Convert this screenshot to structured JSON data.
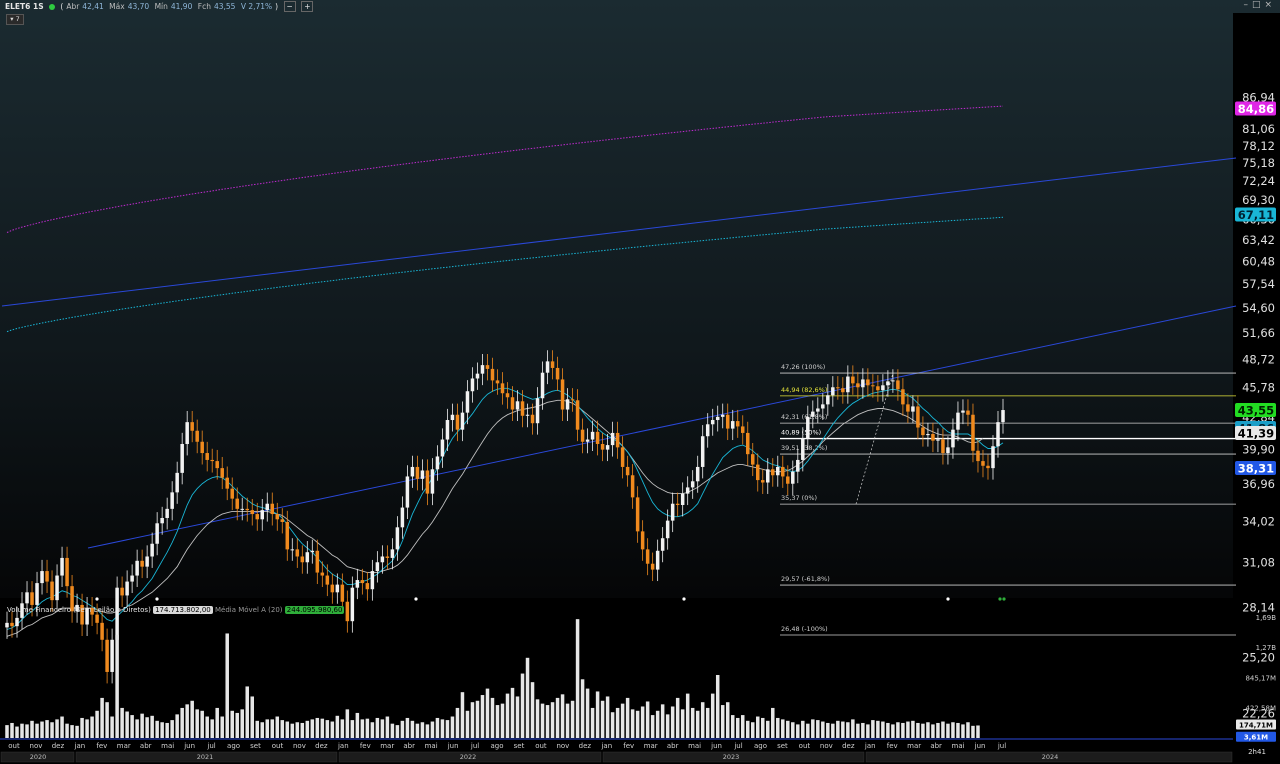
{
  "header": {
    "symbol": "ELET6 1S",
    "open_label": "Abr",
    "open": "42,41",
    "high_label": "Máx",
    "high": "43,70",
    "low_label": "Mín",
    "low": "41,90",
    "close_label": "Fch",
    "close": "43,55",
    "change": "V 2,71%",
    "btn_minus": "−",
    "btn_plus": "+",
    "window_buttons": [
      "–",
      "□",
      "×"
    ]
  },
  "timeframe_button": "▾ 7",
  "price_axis": {
    "ticks": [
      "86,94",
      "81,06",
      "78,12",
      "75,18",
      "72,24",
      "69,30",
      "66,36",
      "63,42",
      "60,48",
      "57,54",
      "54,60",
      "51,66",
      "48,72",
      "45,78",
      "42,84",
      "39,90",
      "36,96",
      "34,02",
      "31,08",
      "28,14",
      "25,20",
      "22,26"
    ],
    "tick_values": [
      86.94,
      81.06,
      78.12,
      75.18,
      72.24,
      69.3,
      66.36,
      63.42,
      60.48,
      57.54,
      54.6,
      51.66,
      48.72,
      45.78,
      42.84,
      39.9,
      36.96,
      34.02,
      31.08,
      28.14,
      25.2,
      22.26
    ],
    "badges": [
      {
        "label": "84,86",
        "value": 84.86,
        "color": "#e026e6",
        "text_color": "#ffffff"
      },
      {
        "label": "67,11",
        "value": 67.11,
        "color": "#19b6d6",
        "text_color": "#002030"
      },
      {
        "label": "43,55",
        "value": 43.55,
        "color": "#22dd22",
        "text_color": "#002200"
      },
      {
        "label": "41,86",
        "value": 41.86,
        "color": "#1a9ec8",
        "text_color": "#002030"
      },
      {
        "label": "41,39",
        "value": 41.39,
        "color": "#e8e8e8",
        "text_color": "#000000"
      },
      {
        "label": "38,31",
        "value": 38.31,
        "color": "#2258e6",
        "text_color": "#ffffff"
      }
    ]
  },
  "fibonacci": [
    {
      "label": "47,26 (100%)",
      "value": 47.26,
      "color": "#cfcfcf"
    },
    {
      "label": "44,94 (82,6%)",
      "value": 44.94,
      "color": "#e4e43a"
    },
    {
      "label": "42,31 (61,8%)",
      "value": 42.31,
      "color": "#cfcfcf"
    },
    {
      "label": "40,89 (50%)",
      "value": 40.89,
      "color": "#ffffff"
    },
    {
      "label": "39,51 (38,2%)",
      "value": 39.51,
      "color": "#cfcfcf"
    },
    {
      "label": "35,37 (0%)",
      "value": 35.37,
      "color": "#cfcfcf"
    },
    {
      "label": "29,57 (-61,8%)",
      "value": 29.57,
      "color": "#cfcfcf"
    },
    {
      "label": "26,48 (-100%)",
      "value": 26.48,
      "color": "#cfcfcf"
    }
  ],
  "volume_header": {
    "title": "Volume Financeiro (Sem Leilão e Diretos)",
    "value": "174.713.802,00",
    "ma_label": "Média Móvel A (20)",
    "ma_value": "244.095.980,60"
  },
  "volume_axis": {
    "ticks": [
      "1,69B",
      "1,27B",
      "845,17M",
      "422,58M"
    ],
    "tick_values": [
      1690,
      1270,
      845.17,
      422.58
    ],
    "badges": [
      {
        "label": "174,71M",
        "value": 174.71,
        "color": "#e8e8e8",
        "text_color": "#000000"
      },
      {
        "label": "3,61M",
        "value": 3.61,
        "color": "#2258e6",
        "text_color": "#ffffff"
      }
    ]
  },
  "time_axis": {
    "months": [
      "out",
      "nov",
      "dez",
      "jan",
      "fev",
      "mar",
      "abr",
      "mai",
      "jun",
      "jul",
      "ago",
      "set",
      "out",
      "nov",
      "dez",
      "jan",
      "fev",
      "mar",
      "abr",
      "mai",
      "jun",
      "jul",
      "ago",
      "set",
      "out",
      "nov",
      "dez",
      "jan",
      "fev",
      "mar",
      "abr",
      "mai",
      "jun",
      "jul",
      "ago",
      "set",
      "out",
      "nov",
      "dez",
      "jan",
      "fev",
      "mar",
      "abr",
      "mai",
      "jun",
      "jul"
    ],
    "years": [
      "2020",
      "2021",
      "2022",
      "2023",
      "2024"
    ],
    "period_label": "2h41"
  },
  "colors": {
    "up": "#f2f2f2",
    "down": "#f08a1e",
    "ma_fast": "#19b6d6",
    "ma_slow": "#bfbfbf",
    "channel": "#2a48d8",
    "env_upper": "#c02ad0",
    "env_lower": "#19b6d6"
  },
  "chart_data": {
    "type": "candlestick",
    "title": "ELET6 1S",
    "interval": "weekly",
    "x_range": [
      "2020-10",
      "2024-07"
    ],
    "ylim": [
      20.5,
      88.5
    ],
    "close_series": [
      27.2,
      27.0,
      27.5,
      28.4,
      29.1,
      28.3,
      29.7,
      30.5,
      29.8,
      28.6,
      30.2,
      31.4,
      29.5,
      27.9,
      28.3,
      27.1,
      28.1,
      27.7,
      27.2,
      26.2,
      24.4,
      26.2,
      29.4,
      28.9,
      29.8,
      30.2,
      31.2,
      30.8,
      31.5,
      32.4,
      33.9,
      34.3,
      35.0,
      36.3,
      37.9,
      40.4,
      42.4,
      41.6,
      40.6,
      39.6,
      39.0,
      38.9,
      38.3,
      37.5,
      36.6,
      35.8,
      35.0,
      35.0,
      34.9,
      34.6,
      34.2,
      34.9,
      35.4,
      34.6,
      34.2,
      34.0,
      32.0,
      32.0,
      31.5,
      31.1,
      31.8,
      31.9,
      30.4,
      30.2,
      29.6,
      29.1,
      29.6,
      28.5,
      27.3,
      29.4,
      29.9,
      29.7,
      29.3,
      30.5,
      31.1,
      31.5,
      31.4,
      32.0,
      33.6,
      35.1,
      37.6,
      38.4,
      37.4,
      38.1,
      36.2,
      38.2,
      39.3,
      40.8,
      42.6,
      43.1,
      41.7,
      43.3,
      45.4,
      46.7,
      47.2,
      48.1,
      47.7,
      46.5,
      46.2,
      45.2,
      44.8,
      43.6,
      44.4,
      43.0,
      43.1,
      42.3,
      44.7,
      47.3,
      48.5,
      47.8,
      46.6,
      43.6,
      44.6,
      44.5,
      41.7,
      40.6,
      40.8,
      41.5,
      40.4,
      39.9,
      40.3,
      41.4,
      40.1,
      38.4,
      37.7,
      35.9,
      33.3,
      32.0,
      31.0,
      30.6,
      31.9,
      32.8,
      34.1,
      35.4,
      35.3,
      36.2,
      36.7,
      37.2,
      38.4,
      41.1,
      42.2,
      42.6,
      42.9,
      43.1,
      41.8,
      42.5,
      42.0,
      41.4,
      39.5,
      38.6,
      37.3,
      37.1,
      38.2,
      37.7,
      38.4,
      37.6,
      37.0,
      38.0,
      39.0,
      40.9,
      42.9,
      43.4,
      43.7,
      44.1,
      45.0,
      45.8,
      45.7,
      45.3,
      46.9,
      46.2,
      45.8,
      46.6,
      46.0,
      45.9,
      45.5,
      46.0,
      46.4,
      46.5,
      45.6,
      44.1,
      43.4,
      43.9,
      41.9,
      41.2,
      41.3,
      40.7,
      40.8,
      39.6,
      40.1,
      41.7,
      43.3,
      43.5,
      43.1,
      39.8,
      38.9,
      38.5,
      38.3,
      40.2,
      42.4,
      43.55
    ],
    "ma_fast_series": [
      26.8,
      26.9,
      27.1,
      27.4,
      27.7,
      27.9,
      28.2,
      28.5,
      28.7,
      28.8,
      29.0,
      29.2,
      29.1,
      28.9,
      28.8,
      28.6,
      28.4,
      28.2,
      28.0,
      27.7,
      27.4,
      27.3,
      27.6,
      27.9,
      28.2,
      28.5,
      28.9,
      29.2,
      29.6,
      30.0,
      30.6,
      31.2,
      31.8,
      32.5,
      33.3,
      34.3,
      35.3,
      36.1,
      36.6,
      37.0,
      37.3,
      37.5,
      37.6,
      37.5,
      37.2,
      36.8,
      36.4,
      36.0,
      35.7,
      35.4,
      35.2,
      35.1,
      35.0,
      34.8,
      34.6,
      34.3,
      33.8,
      33.3,
      32.8,
      32.4,
      32.1,
      31.8,
      31.4,
      31.0,
      30.6,
      30.3,
      30.1,
      29.9,
      29.6,
      29.6,
      29.7,
      29.8,
      29.9,
      30.1,
      30.3,
      30.6,
      30.9,
      31.2,
      31.8,
      32.6,
      33.6,
      34.6,
      35.4,
      36.2,
      36.8,
      37.5,
      38.3,
      39.2,
      40.1,
      40.9,
      41.5,
      42.0,
      42.6,
      43.2,
      43.9,
      44.6,
      45.1,
      45.4,
      45.6,
      45.7,
      45.7,
      45.5,
      45.3,
      45.0,
      44.8,
      44.6,
      44.7,
      44.9,
      45.2,
      45.4,
      45.5,
      45.3,
      45.0,
      44.6,
      44.0,
      43.4,
      42.8,
      42.3,
      41.8,
      41.4,
      41.1,
      40.9,
      40.6,
      40.2,
      39.7,
      39.0,
      38.1,
      37.2,
      36.3,
      35.5,
      35.0,
      34.7,
      34.5,
      34.4,
      34.4,
      34.5,
      34.7,
      35.0,
      35.4,
      36.2,
      37.0,
      37.8,
      38.5,
      39.2,
      39.6,
      40.0,
      40.2,
      40.3,
      40.1,
      39.8,
      39.4,
      39.0,
      38.8,
      38.6,
      38.5,
      38.3,
      38.1,
      38.0,
      38.1,
      38.4,
      38.9,
      39.5,
      40.1,
      40.8,
      41.5,
      42.2,
      42.8,
      43.3,
      43.8,
      44.2,
      44.5,
      44.8,
      45.0,
      45.2,
      45.3,
      45.4,
      45.5,
      45.6,
      45.5,
      45.3,
      45.0,
      44.7,
      44.2,
      43.7,
      43.3,
      42.8,
      42.4,
      41.9,
      41.5,
      41.3,
      41.3,
      41.3,
      41.3,
      41.0,
      40.7,
      40.3,
      40.0,
      40.0,
      40.2,
      40.5
    ],
    "ma_slow_series": [
      26.4,
      26.5,
      26.6,
      26.8,
      27.0,
      27.1,
      27.3,
      27.5,
      27.6,
      27.7,
      27.9,
      28.1,
      28.1,
      28.1,
      28.1,
      28.1,
      28.1,
      28.1,
      28.0,
      27.9,
      27.8,
      27.8,
      27.9,
      28.0,
      28.2,
      28.3,
      28.5,
      28.7,
      28.9,
      29.1,
      29.4,
      29.7,
      30.0,
      30.4,
      30.8,
      31.4,
      32.0,
      32.5,
      33.0,
      33.4,
      33.8,
      34.1,
      34.4,
      34.6,
      34.7,
      34.8,
      34.8,
      34.8,
      34.8,
      34.8,
      34.8,
      34.8,
      34.8,
      34.7,
      34.6,
      34.5,
      34.2,
      33.9,
      33.6,
      33.3,
      33.0,
      32.8,
      32.5,
      32.2,
      31.9,
      31.6,
      31.4,
      31.1,
      30.8,
      30.7,
      30.6,
      30.5,
      30.4,
      30.4,
      30.4,
      30.5,
      30.6,
      30.7,
      30.9,
      31.2,
      31.6,
      32.1,
      32.6,
      33.1,
      33.5,
      34.0,
      34.6,
      35.2,
      35.9,
      36.6,
      37.2,
      37.8,
      38.5,
      39.2,
      39.9,
      40.6,
      41.3,
      41.9,
      42.4,
      42.8,
      43.1,
      43.3,
      43.5,
      43.6,
      43.7,
      43.8,
      43.9,
      44.1,
      44.3,
      44.4,
      44.5,
      44.5,
      44.4,
      44.2,
      43.9,
      43.5,
      43.1,
      42.7,
      42.3,
      41.9,
      41.5,
      41.1,
      40.7,
      40.2,
      39.7,
      39.1,
      38.5,
      37.9,
      37.4,
      37.0,
      36.7,
      36.5,
      36.3,
      36.2,
      36.2,
      36.2,
      36.3,
      36.5,
      36.7,
      37.0,
      37.3,
      37.6,
      37.9,
      38.1,
      38.3,
      38.5,
      38.6,
      38.6,
      38.5,
      38.4,
      38.3,
      38.2,
      38.1,
      38.0,
      38.0,
      38.0,
      38.1,
      38.3,
      38.6,
      38.9,
      39.3,
      39.7,
      40.1,
      40.6,
      41.0,
      41.4,
      41.8,
      42.2,
      42.5,
      42.8,
      43.1,
      43.3,
      43.5,
      43.6,
      43.7,
      43.7,
      43.6,
      43.5,
      43.3,
      43.1,
      42.9,
      42.6,
      42.3,
      42.0,
      41.7,
      41.5,
      41.3,
      41.2,
      41.2,
      41.2,
      41.0,
      40.8,
      40.6,
      40.5,
      40.6,
      40.9
    ],
    "volume_series_millions": [
      180,
      210,
      160,
      200,
      190,
      240,
      200,
      230,
      250,
      220,
      260,
      300,
      200,
      180,
      170,
      280,
      260,
      300,
      380,
      560,
      500,
      300,
      1440,
      420,
      370,
      320,
      260,
      340,
      290,
      310,
      240,
      220,
      210,
      250,
      330,
      420,
      470,
      520,
      400,
      380,
      300,
      260,
      420,
      300,
      1460,
      380,
      350,
      400,
      720,
      580,
      240,
      220,
      260,
      260,
      300,
      250,
      230,
      200,
      220,
      210,
      240,
      260,
      280,
      270,
      250,
      230,
      310,
      260,
      400,
      250,
      350,
      260,
      270,
      220,
      280,
      260,
      300,
      200,
      180,
      240,
      280,
      240,
      200,
      220,
      190,
      230,
      280,
      260,
      250,
      300,
      420,
      640,
      380,
      500,
      520,
      600,
      690,
      560,
      460,
      480,
      620,
      700,
      580,
      900,
      1120,
      780,
      540,
      480,
      460,
      500,
      560,
      610,
      480,
      520,
      1660,
      820,
      690,
      420,
      650,
      520,
      580,
      360,
      420,
      480,
      560,
      400,
      380,
      440,
      510,
      320,
      380,
      470,
      330,
      440,
      560,
      400,
      620,
      420,
      380,
      500,
      420,
      620,
      880,
      460,
      500,
      320,
      280,
      320,
      240,
      220,
      300,
      280,
      240,
      420,
      280,
      260,
      240,
      220,
      190,
      240,
      200,
      260,
      250,
      230,
      210,
      200,
      240,
      230,
      220,
      260,
      200,
      210,
      190,
      250,
      240,
      230,
      210,
      190,
      220,
      210,
      230,
      240,
      210,
      200,
      220,
      190,
      210,
      230,
      200,
      220,
      210,
      190,
      220,
      170,
      175
    ]
  }
}
